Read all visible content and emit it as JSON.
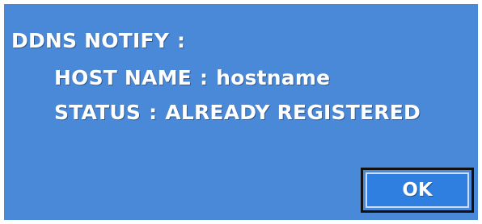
{
  "dialog": {
    "title": "DDNS NOTIFY",
    "title_sep": ":",
    "host_label": "HOST NAME",
    "host_sep": ":",
    "host_value": "hostname",
    "status_label": "STATUS",
    "status_sep": ":",
    "status_value": "ALREADY REGISTERED",
    "ok_label": "OK"
  },
  "colors": {
    "dialog_background": "#4a88d8",
    "button_fill": "#2f7fe0",
    "button_border": "#111111",
    "text": "#ffffff"
  }
}
